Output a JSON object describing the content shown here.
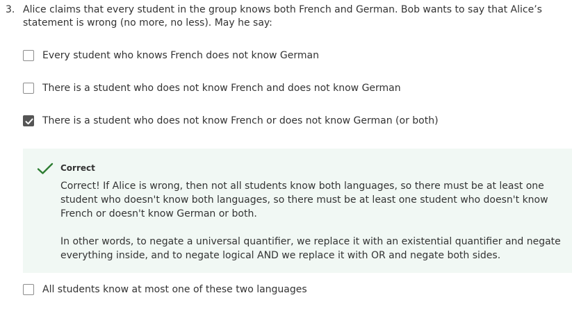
{
  "question": {
    "number": "3.",
    "text": "Alice claims that every student in the group knows both French and German. Bob wants to say that Alice’s statement is wrong (no more, no less). May he say:"
  },
  "options": [
    {
      "label": "Every student who knows French does not know German",
      "checked": false
    },
    {
      "label": "There is a student who does not know French and does not know German",
      "checked": false
    },
    {
      "label": "There is a student who does not know French or does not know German (or both)",
      "checked": true
    },
    {
      "label": "All students know at most one of these two languages",
      "checked": false
    }
  ],
  "feedback": {
    "icon": "checkmark-icon",
    "title": "Correct",
    "paragraph1": "Correct! If Alice is wrong, then not all students know both languages, so there must be at least one student who doesn't know both languages, so there must be at least one student who doesn't know French or doesn't know German or both.",
    "paragraph2": "In other words, to negate a universal quantifier, we replace it with an existential quantifier and negate everything inside, and to negate logical AND we replace it with OR and negate both sides."
  },
  "colors": {
    "feedback_background": "#f1f8f4",
    "success_green": "#2e7d32",
    "checked_box": "#555555"
  }
}
